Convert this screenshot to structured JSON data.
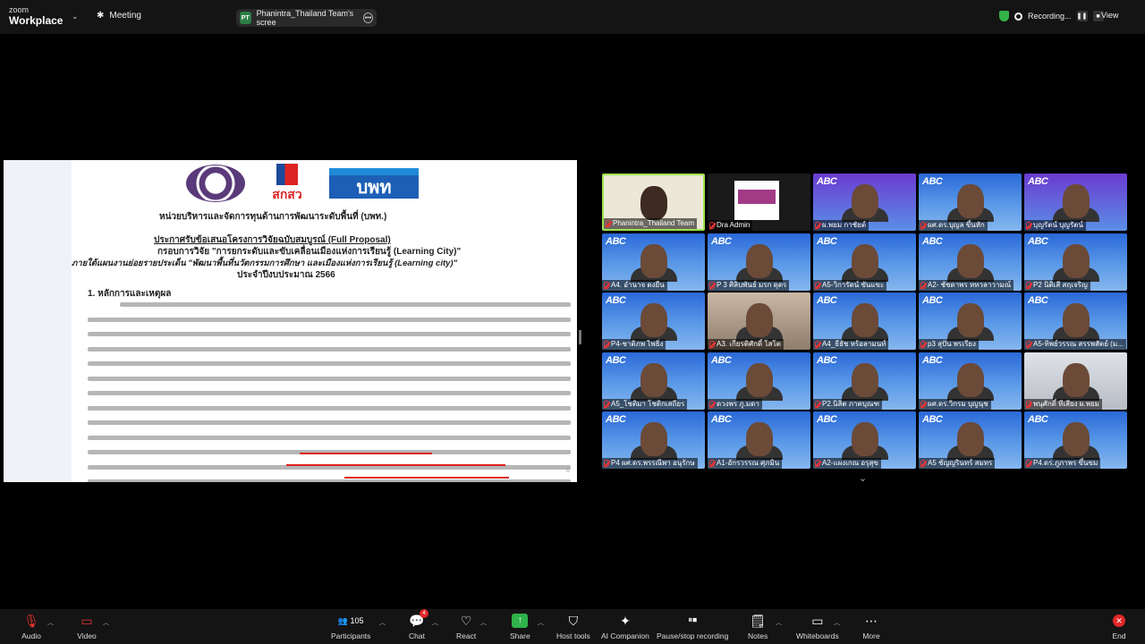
{
  "topbar": {
    "logo_top": "zoom",
    "logo_bottom": "Workplace",
    "meeting_label": "Meeting",
    "screen_share_label": "Phanintra_Thailand Team's scree",
    "screen_share_initials": "PT",
    "recording_label": "Recording...",
    "view_label": "View"
  },
  "document": {
    "heading": "หน่วยบริหารและจัดการทุนด้านการพัฒนาระดับพื้นที่ (บพท.)",
    "title1": "ประกาศรับข้อเสนอโครงการวิจัยฉบับสมบูรณ์ (Full Proposal)",
    "title2": "กรอบการวิจัย \"การยกระดับและขับเคลื่อนเมืองแห่งการเรียนรู้ (Learning City)\"",
    "title3": "ภายใต้แผนงานย่อยรายประเด็น \"พัฒนาพื้นที่นวัตกรรมการศึกษา และเมืองแห่งการเรียนรู้ (Learning city)\"",
    "title4": "ประจำปีงบประมาณ 2566",
    "section": "1. หลักการและเหตุผล",
    "logo_tsri": "สกสว",
    "logo_pmu": "บพท",
    "page_number": "6"
  },
  "participants_grid": [
    {
      "name": "Phanintra_Thailand Team",
      "style": "lc"
    },
    {
      "name": "Dra Admin",
      "style": "dra"
    },
    {
      "name": "ผ.พยม กาชัยต์",
      "style": "purple"
    },
    {
      "name": "ผศ.ดร.บุญล ขึ้นหัก",
      "style": "sky"
    },
    {
      "name": "บุญรัตน์ บุญรัตน์",
      "style": "purple"
    },
    {
      "name": "A4. อำนาจ ดงยืน",
      "style": "sky"
    },
    {
      "name": "P 3 ศิลิบพันธ์ มรก ดุตร",
      "style": "sky"
    },
    {
      "name": "A5-วิการัตน์ ขันแขะ",
      "style": "sky"
    },
    {
      "name": "A2- ชัชดาพร หทวลาวามณ์",
      "style": "sky"
    },
    {
      "name": "P2 นิติเสี สฤเจริญ",
      "style": "sky"
    },
    {
      "name": "P4-ชาติภพ ไพธิ่ง",
      "style": "sky"
    },
    {
      "name": "A3. เกียรติศักดิ์ โสโต",
      "style": "room"
    },
    {
      "name": "A4_ธีธัช หร้อลามนท์",
      "style": "sky"
    },
    {
      "name": "p3 สุปัน พรเรียง",
      "style": "sky"
    },
    {
      "name": "A5-ทิพย์วรรณ สรรพสัตย์ (ม...",
      "style": "sky"
    },
    {
      "name": "A5_โชติมา โชติกเสถียร",
      "style": "sky"
    },
    {
      "name": "ดวงพร ภู.มดา",
      "style": "sky"
    },
    {
      "name": "P2.นิสิต ภาคบุณฑ",
      "style": "sky"
    },
    {
      "name": "ผศ.ดร.วิกรม บุญนุช",
      "style": "sky"
    },
    {
      "name": "พนุศักดิ์ ทีเสียง ผ.พยม",
      "style": "grey"
    },
    {
      "name": "P4 ผศ.ดร.พรรณีพา อนุรักษ",
      "style": "sky"
    },
    {
      "name": "A1-อักรวรรณ ศุภมิน",
      "style": "sky"
    },
    {
      "name": "A2-แผงเกณ อรุสุข",
      "style": "sky"
    },
    {
      "name": "A5 ชัญญรินทร์ สมทร",
      "style": "sky"
    },
    {
      "name": "P4.ดร.ภูภาพร ขึ้นขม",
      "style": "sky"
    }
  ],
  "toolbar": {
    "audio": "Audio",
    "video": "Video",
    "participants": "Participants",
    "participants_count": "105",
    "chat": "Chat",
    "chat_badge": "4",
    "react": "React",
    "share": "Share",
    "host_tools": "Host tools",
    "ai_companion": "AI Companion",
    "pause_recording": "Pause/stop recording",
    "notes": "Notes",
    "whiteboards": "Whiteboards",
    "more": "More",
    "end": "End"
  }
}
